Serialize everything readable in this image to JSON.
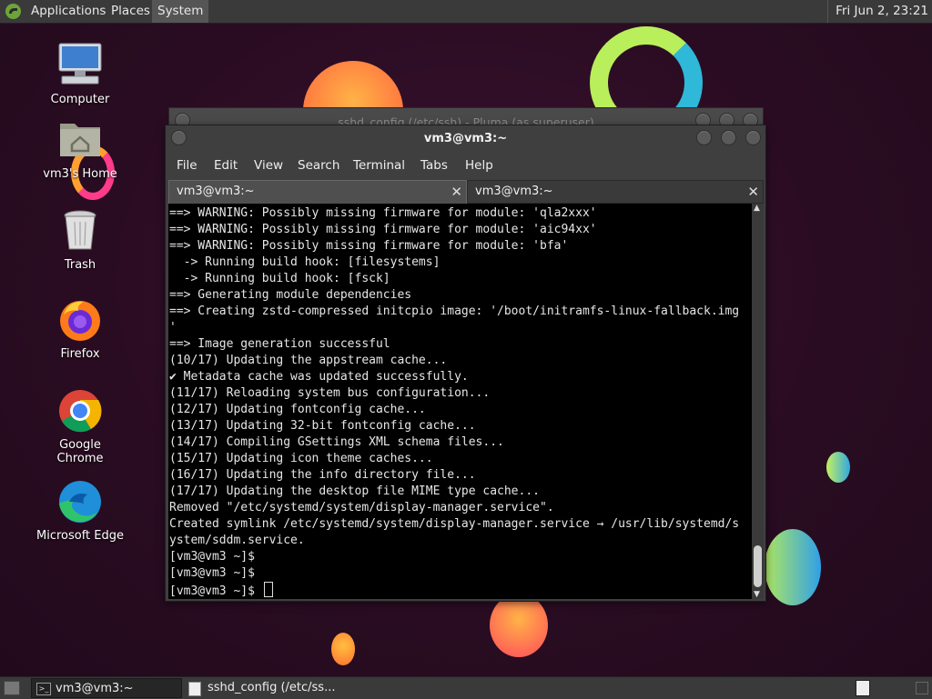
{
  "top_panel": {
    "menus": [
      "Applications",
      "Places",
      "System"
    ],
    "clock": "Fri Jun  2, 23:21"
  },
  "desktop": {
    "icons": [
      {
        "label": "Computer",
        "icon": "computer-icon"
      },
      {
        "label": "vm3's Home",
        "icon": "home-folder-icon"
      },
      {
        "label": "Trash",
        "icon": "trash-icon"
      },
      {
        "label": "Firefox",
        "icon": "firefox-icon"
      },
      {
        "label": "Google Chrome",
        "icon": "chrome-icon"
      },
      {
        "label": "Microsoft Edge",
        "icon": "edge-icon"
      }
    ]
  },
  "background_window": {
    "title": "sshd_config (/etc/ssh) - Pluma (as superuser)"
  },
  "terminal": {
    "title": "vm3@vm3:~",
    "menu": [
      "File",
      "Edit",
      "View",
      "Search",
      "Terminal",
      "Tabs",
      "Help"
    ],
    "tabs": [
      {
        "label": "vm3@vm3:~"
      },
      {
        "label": "vm3@vm3:~"
      }
    ],
    "lines": [
      "==> WARNING: Possibly missing firmware for module: 'qla2xxx'",
      "==> WARNING: Possibly missing firmware for module: 'aic94xx'",
      "==> WARNING: Possibly missing firmware for module: 'bfa'",
      "  -> Running build hook: [filesystems]",
      "  -> Running build hook: [fsck]",
      "==> Generating module dependencies",
      "==> Creating zstd-compressed initcpio image: '/boot/initramfs-linux-fallback.img",
      "'",
      "==> Image generation successful",
      "(10/17) Updating the appstream cache...",
      "✔ Metadata cache was updated successfully.",
      "(11/17) Reloading system bus configuration...",
      "(12/17) Updating fontconfig cache...",
      "(13/17) Updating 32-bit fontconfig cache...",
      "(14/17) Compiling GSettings XML schema files...",
      "(15/17) Updating icon theme caches...",
      "(16/17) Updating the info directory file...",
      "(17/17) Updating the desktop file MIME type cache...",
      "Removed \"/etc/systemd/system/display-manager.service\".",
      "Created symlink /etc/systemd/system/display-manager.service → /usr/lib/systemd/s",
      "ystem/sddm.service.",
      "[vm3@vm3 ~]$",
      "[vm3@vm3 ~]$",
      "[vm3@vm3 ~]$ "
    ]
  },
  "taskbar": {
    "items": [
      {
        "label": "vm3@vm3:~",
        "icon": "terminal-icon"
      },
      {
        "label": "sshd_config (/etc/ss...",
        "icon": "text-editor-icon"
      }
    ]
  },
  "colors": {
    "panel": "#3a3a3a",
    "terminal_bg": "#000000",
    "desktop_bg": "#2a0c22"
  }
}
